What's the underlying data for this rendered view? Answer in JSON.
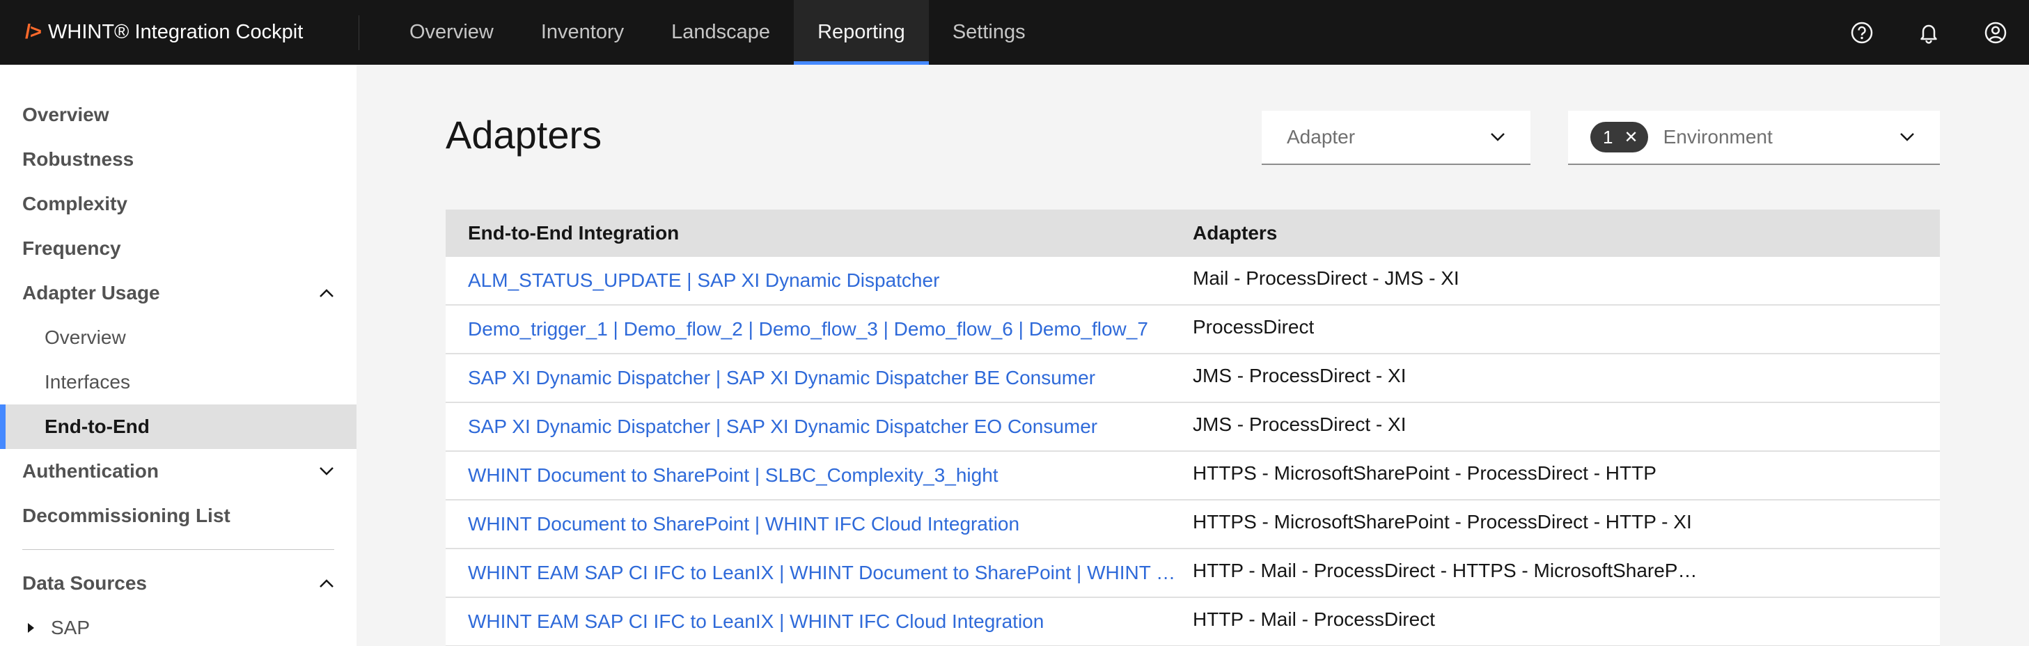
{
  "header": {
    "brand_mark": "/>",
    "brand_name": "WHINT® Integration Cockpit",
    "nav": [
      {
        "label": "Overview"
      },
      {
        "label": "Inventory"
      },
      {
        "label": "Landscape"
      },
      {
        "label": "Reporting",
        "active": true
      },
      {
        "label": "Settings"
      }
    ],
    "icons": [
      "help-icon",
      "notification-icon",
      "user-profile-icon"
    ]
  },
  "sidebar": {
    "items": [
      {
        "label": "Overview"
      },
      {
        "label": "Robustness"
      },
      {
        "label": "Complexity"
      },
      {
        "label": "Frequency"
      },
      {
        "label": "Adapter Usage",
        "expanded": true
      },
      {
        "label": "Overview"
      },
      {
        "label": "Interfaces"
      },
      {
        "label": "End-to-End",
        "active": true
      },
      {
        "label": "Authentication",
        "expanded": false
      },
      {
        "label": "Decommissioning List"
      },
      {
        "label": "Data Sources",
        "expanded": true
      },
      {
        "label": "SAP"
      }
    ]
  },
  "main": {
    "title": "Adapters",
    "filters": {
      "adapter_label": "Adapter",
      "environment_count": "1",
      "environment_label": "Environment"
    },
    "table": {
      "headers": [
        "End-to-End Integration",
        "Adapters"
      ],
      "rows": [
        {
          "integration": "ALM_STATUS_UPDATE | SAP XI Dynamic Dispatcher",
          "adapters": "Mail - ProcessDirect - JMS - XI"
        },
        {
          "integration": "Demo_trigger_1 | Demo_flow_2 | Demo_flow_3 | Demo_flow_6 | Demo_flow_7",
          "adapters": "ProcessDirect"
        },
        {
          "integration": "SAP XI Dynamic Dispatcher | SAP XI Dynamic Dispatcher BE Consumer",
          "adapters": "JMS - ProcessDirect - XI"
        },
        {
          "integration": "SAP XI Dynamic Dispatcher | SAP XI Dynamic Dispatcher EO Consumer",
          "adapters": "JMS - ProcessDirect - XI"
        },
        {
          "integration": "WHINT Document to SharePoint | SLBC_Complexity_3_hight",
          "adapters": "HTTPS - MicrosoftSharePoint - ProcessDirect - HTTP"
        },
        {
          "integration": "WHINT Document to SharePoint | WHINT IFC Cloud Integration",
          "adapters": "HTTPS - MicrosoftSharePoint - ProcessDirect - HTTP - XI"
        },
        {
          "integration": "WHINT EAM SAP CI IFC to LeanIX | WHINT Document to SharePoint | WHINT IFC Cloud Integration",
          "adapters": "HTTP - Mail - ProcessDirect - HTTPS - MicrosoftSharePoint"
        },
        {
          "integration": "WHINT EAM SAP CI IFC to LeanIX | WHINT IFC Cloud Integration",
          "adapters": "HTTP - Mail - ProcessDirect"
        }
      ]
    }
  },
  "colors": {
    "header_bg": "#161616",
    "accent_blue": "#4589ff",
    "link": "#2f6ad9",
    "brand_orange": "#ff6a2b"
  }
}
